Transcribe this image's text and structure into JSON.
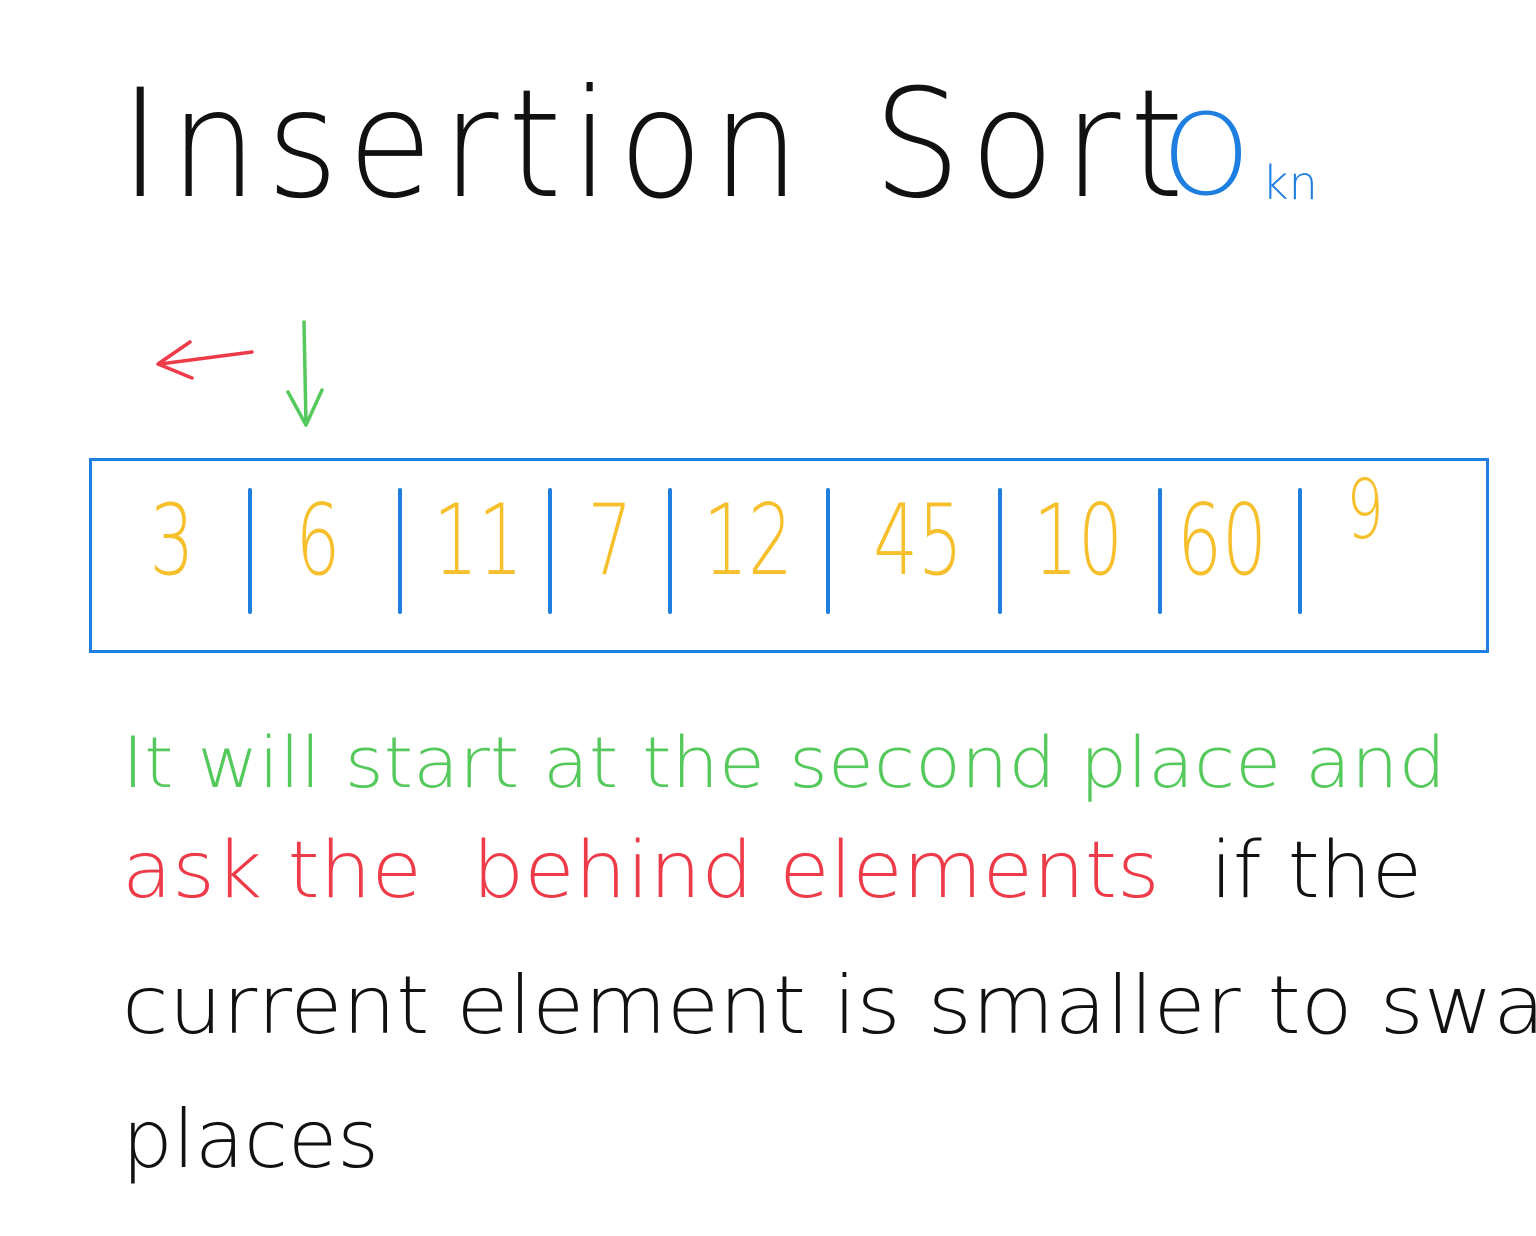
{
  "colors": {
    "ink": "#111111",
    "blue": "#1e7fe0",
    "yellow": "#f6bf2c",
    "green": "#55c95b",
    "red": "#ee3b49"
  },
  "title": {
    "word1": "Insertion",
    "word2": "Sort"
  },
  "badge": {
    "big": "O",
    "small": "kn"
  },
  "arrows": {
    "left_arrow": "arrow-left-icon",
    "down_arrow": "arrow-down-icon"
  },
  "array": {
    "values": [
      "3",
      "6",
      "11",
      "7",
      "12",
      "45",
      "10",
      "60",
      "9"
    ]
  },
  "note": {
    "line1": "It will start at the second place and",
    "line2_red1": "ask",
    "line2_red2": "the",
    "line2_red3": "behind elements",
    "line2_black": "if the",
    "line3": "current element is smaller to swap",
    "line4": "places"
  }
}
